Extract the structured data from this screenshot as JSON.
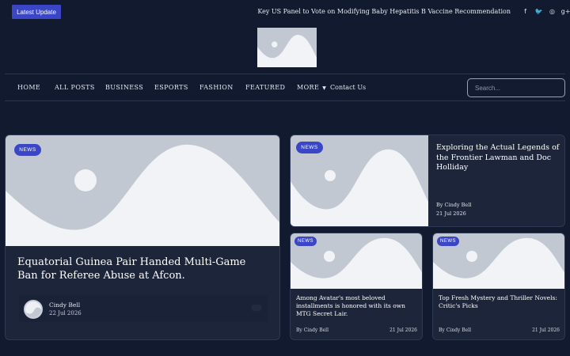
{
  "topbar": {
    "latest_label": "Latest Update",
    "ticker_text": "Key US Panel to Vote on Modifying Baby Hepatitis B Vaccine Recommendation",
    "socials": [
      {
        "name": "facebook-icon",
        "glyph": "f"
      },
      {
        "name": "twitter-icon",
        "glyph": "🐦"
      },
      {
        "name": "instagram-icon",
        "glyph": "◎"
      },
      {
        "name": "google-plus-icon",
        "glyph": "g+"
      }
    ]
  },
  "nav": {
    "items": [
      "HOME",
      "ALL POSTS",
      "BUSINESS",
      "ESPORTS",
      "FASHION",
      "FEATURED",
      "MORE",
      "Contact Us"
    ],
    "search_placeholder": "Search..."
  },
  "featured": {
    "badge": "NEWS",
    "title": "Equatorial Guinea Pair Handed Multi-Game Ban for Referee Abuse at Afcon.",
    "author": "Cindy Bell",
    "date": "22 Jul 2026"
  },
  "right_top": {
    "badge": "NEWS",
    "title": "Exploring the Actual Legends of the Frontier Lawman and Doc Holliday",
    "author": "By Cindy Bell",
    "date": "21 Jul 2026"
  },
  "small_cards": [
    {
      "badge": "NEWS",
      "title": "Among Avatar's most beloved installments is honored with its own MTG Secret Lair.",
      "author": "By Cindy Bell",
      "date": "21 Jul 2026"
    },
    {
      "badge": "NEWS",
      "title": "Top Fresh Mystery and Thriller Novels: Critic's Picks",
      "author": "By Cindy Bell",
      "date": "21 Jul 2026"
    }
  ],
  "colors": {
    "background": "#111a2e",
    "accent": "#3b46c7",
    "card": "#1c2539",
    "placeholder": "#c2c8d1"
  }
}
